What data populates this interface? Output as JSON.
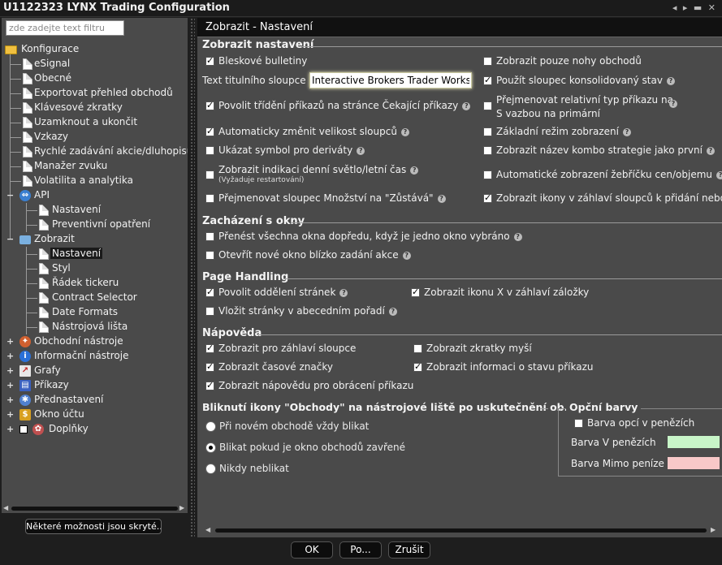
{
  "window": {
    "title": "U1122323 LYNX Trading Configuration",
    "controls": "◂ ▸ ▬ ✕"
  },
  "sidebar": {
    "filter_placeholder": "zde zadejte text filtru",
    "root": "Konfigurace",
    "items": [
      "eSignal",
      "Obecné",
      "Exportovat přehled obchodů",
      "Klávesové zkratky",
      "Uzamknout a ukončit",
      "Vzkazy",
      "Rychlé zadávání akcie/dluhopisu",
      "Manažer zvuku",
      "Volatilita a analytika"
    ],
    "api": {
      "label": "API",
      "children": [
        "Nastavení",
        "Preventivní opatření"
      ]
    },
    "zobrazit": {
      "label": "Zobrazit",
      "children": [
        "Nastavení",
        "Styl",
        "Řádek tickeru",
        "Contract Selector",
        "Date Formats",
        "Nástrojová lišta"
      ]
    },
    "groups": [
      "Obchodní nástroje",
      "Informační nástroje",
      "Grafy",
      "Příkazy",
      "Přednastavení",
      "Okno účtu",
      "Doplňky"
    ],
    "hidden_options_button": "Některé možnosti jsou skryté..."
  },
  "panel": {
    "header": "Zobrazit - Nastavení",
    "section_display": "Zobrazit nastavení",
    "c_flash": "Bleskové bulletiny",
    "c_legs_only": "Zobrazit pouze nohy obchodů",
    "title_label": "Text titulního sloupce",
    "title_value": "Interactive Brokers Trader Workstation",
    "c_consolidated": "Použít sloupec konsolidovaný stav",
    "c_sort_pending": "Povolit třídění příkazů na stránce Čekající příkazy",
    "c_rename_relative_1": "Přejmenovat relativní typ příkazu na",
    "c_rename_relative_2": "S vazbou na primární",
    "c_auto_resize": "Automaticky změnit velikost sloupců",
    "c_basic_mode": "Základní režim zobrazení",
    "c_deriv_symbol": "Ukázat symbol pro deriváty",
    "c_combo_name": "Zobrazit název kombo strategie jako první",
    "c_dst": "Zobrazit indikaci denní světlo/letní čas",
    "c_dst_note": "(Vyžaduje restartování)",
    "c_auto_ladder": "Automatické zobrazení žebříčku cen/objemu",
    "c_rename_qty": "Přejmenovat sloupec Množství na \"Zůstává\"",
    "c_header_icons": "Zobrazit ikony v záhlaví sloupců k přidání nebo o",
    "section_windows": "Zacházení s okny",
    "c_bring_front": "Přenést všechna okna dopředu, když je jedno okno vybráno",
    "c_open_near": "Otevřít nové okno blízko zadání akce",
    "section_page": "Page Handling",
    "c_page_sep": "Povolit oddělení stránek",
    "c_tab_x": "Zobrazit ikonu X v záhlaví záložky",
    "c_alpha": "Vložit stránky v abecedním pořadí",
    "section_help": "Nápověda",
    "c_col_header": "Zobrazit pro záhlaví sloupce",
    "c_mouse": "Zobrazit zkratky myší",
    "c_time_marks": "Zobrazit časové značky",
    "c_order_state": "Zobrazit informaci o stavu příkazu",
    "c_reverse_help": "Zobrazit nápovědu pro obrácení příkazu",
    "section_blink": "Bliknutí ikony \"Obchody\" na nástrojové liště po uskutečnění ob...",
    "r_always": "Při novém obchodě vždy blikat",
    "r_closed": "Blikat pokud je okno obchodů zavřené",
    "r_never": "Nikdy neblikat",
    "section_option_colors": "Opční barvy",
    "c_itm_color": "Barva opcí v penězích",
    "itm_label": "Barva V penězích",
    "otm_label": "Barva Mimo peníze",
    "itm_color": "#c8f5c8",
    "otm_color": "#f8c8c8"
  },
  "buttons": {
    "ok": "OK",
    "apply": "Po...",
    "cancel": "Zrušit"
  }
}
